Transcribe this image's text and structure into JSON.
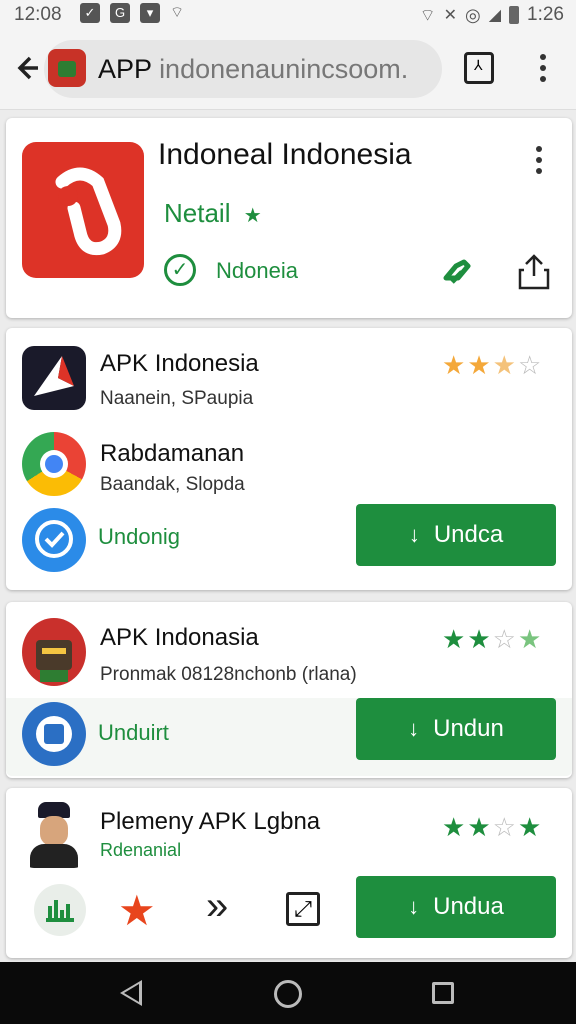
{
  "status": {
    "time": "12:08",
    "right_time": "1:26",
    "icons": [
      "notification-icon",
      "notification-icon",
      "notification-icon",
      "wifi-icon",
      "wifi-icon",
      "mute-icon",
      "alarm-icon",
      "signal-icon",
      "battery-icon"
    ]
  },
  "browser": {
    "url_main": "APP",
    "url_rest": "indonenaunincsoom."
  },
  "hero": {
    "title": "Indoneal Indonesia",
    "developer": "Netail",
    "verified_label": "Ndoneia"
  },
  "list1": {
    "item1": {
      "title": "APK Indonesia",
      "subtitle": "Naanein, SPaupia",
      "rating": 3.5
    },
    "item2": {
      "title": "Rabdamanan",
      "subtitle": "Baandak, Slopda"
    },
    "item3": {
      "title": "Undonig",
      "button": "Undca"
    }
  },
  "list2": {
    "item1": {
      "title": "APK Indonasia",
      "subtitle": "Pronmak 08128nchonb (rlana)",
      "rating": 2.5,
      "stars": [
        "★",
        "★",
        "☆",
        "★"
      ]
    },
    "item2": {
      "title": "Unduirt",
      "button": "Undun"
    }
  },
  "list3": {
    "item1": {
      "title": "Plemeny APK Lgbna",
      "subtitle": "Rdenanial",
      "rating": 2.5,
      "stars": [
        "★",
        "★",
        "☆",
        "★"
      ]
    },
    "actions": {
      "star": "★",
      "chevrons": "»",
      "expand": "⤢"
    },
    "button": "Undua"
  },
  "colors": {
    "accent": "#1e8e3e",
    "star": "#f4a83a",
    "icon_red": "#dd3327"
  }
}
